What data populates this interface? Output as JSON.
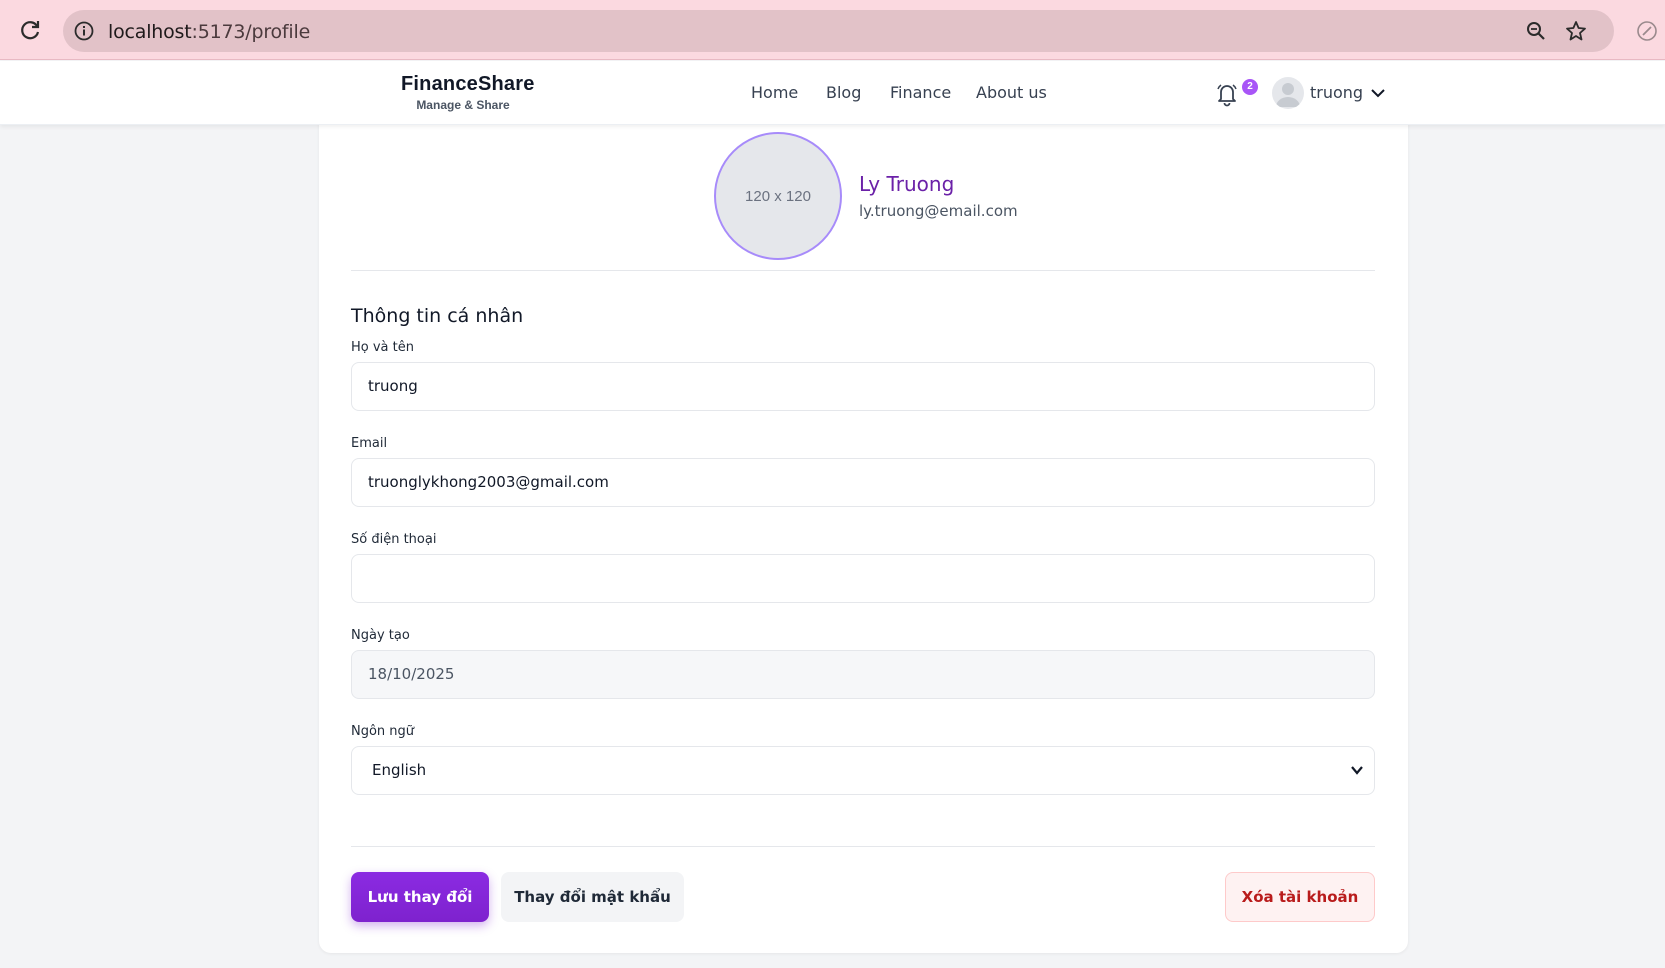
{
  "browser": {
    "url_host": "localhost",
    "url_path": ":5173/profile"
  },
  "header": {
    "brand_name": "FinanceShare",
    "brand_tagline": "Manage & Share",
    "nav": [
      "Home",
      "Blog",
      "Finance",
      "About us"
    ],
    "notification_count": "2",
    "user_name": "truong"
  },
  "profile": {
    "avatar_placeholder": "120 x 120",
    "display_name": "Ly Truong",
    "display_email": "ly.truong@email.com"
  },
  "form": {
    "section_title": "Thông tin cá nhân",
    "fullname_label": "Họ và tên",
    "fullname_value": "truong",
    "email_label": "Email",
    "email_value": "truonglykhong2003@gmail.com",
    "phone_label": "Số điện thoại",
    "phone_value": "",
    "created_label": "Ngày tạo",
    "created_value": "18/10/2025",
    "language_label": "Ngôn ngữ",
    "language_value": "English"
  },
  "actions": {
    "save_label": "Lưu thay đổi",
    "change_password_label": "Thay đổi mật khẩu",
    "delete_label": "Xóa tài khoản"
  },
  "colors": {
    "accent": "#7e22ce",
    "danger": "#b91c1c",
    "browser_bar": "#fbd9e0"
  }
}
